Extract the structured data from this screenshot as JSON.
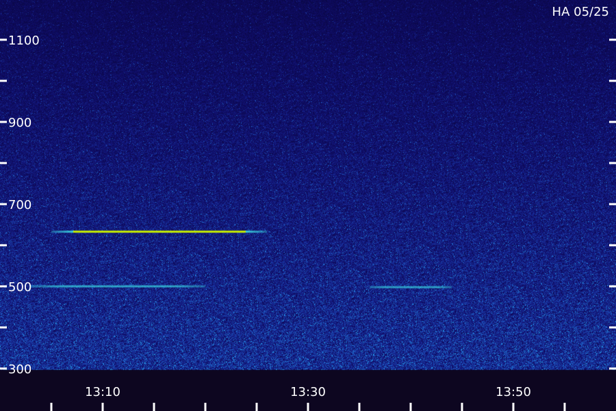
{
  "chart_data": {
    "type": "heatmap",
    "title": "HA 05/25",
    "xlabel": "",
    "ylabel": "",
    "y_ticks": [
      {
        "value": 300,
        "label": "300"
      },
      {
        "value": 500,
        "label": "500"
      },
      {
        "value": 700,
        "label": "700"
      },
      {
        "value": 900,
        "label": "900"
      },
      {
        "value": 1100,
        "label": "1100"
      }
    ],
    "y_minor_ticks": [
      400,
      600,
      800,
      1000,
      1200
    ],
    "ylim": [
      300,
      1200
    ],
    "x_ticks": [
      {
        "value": "13:10",
        "label": "13:10"
      },
      {
        "value": "13:30",
        "label": "13:30"
      },
      {
        "value": "13:50",
        "label": "13:50"
      }
    ],
    "x_minor_ticks": [
      "13:05",
      "13:15",
      "13:20",
      "13:25",
      "13:35",
      "13:40",
      "13:45",
      "13:55"
    ],
    "x_start": "13:02",
    "x_end": "14:02",
    "grid": false,
    "legend": "none",
    "colors": {
      "background": "#06043a",
      "noise_low": "#1a0f8c",
      "noise_high": "#2a6df0",
      "signal": "#c8f000",
      "text": "#ffffff"
    },
    "signals": [
      {
        "start": "13:05",
        "end": "13:26",
        "frequency": 633,
        "intensity": 1.0
      },
      {
        "start": "13:03",
        "end": "13:20",
        "frequency": 500,
        "intensity": 0.35
      },
      {
        "start": "13:36",
        "end": "13:44",
        "frequency": 498,
        "intensity": 0.3
      }
    ]
  }
}
